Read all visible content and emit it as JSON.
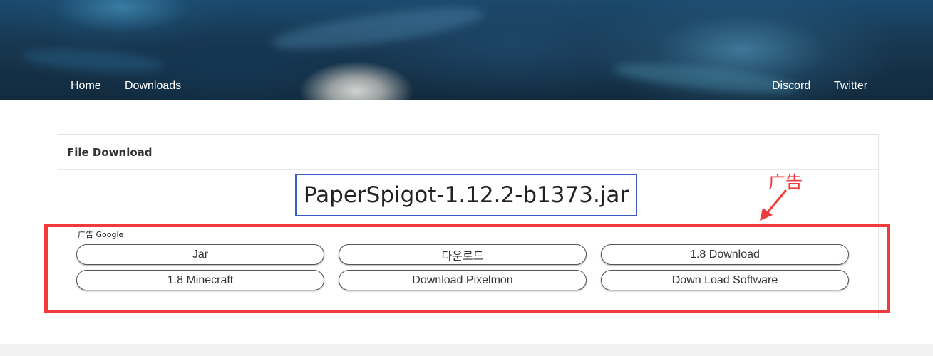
{
  "header": {
    "nav_left": [
      "Home",
      "Downloads"
    ],
    "nav_right": [
      "Discord",
      "Twitter"
    ]
  },
  "card": {
    "title": "File Download",
    "filename": "PaperSpigot-1.12.2-b1373.jar"
  },
  "ad": {
    "label": "广告 Google",
    "buttons": [
      "Jar",
      "다운로드",
      "1.8 Download",
      "1.8 Minecraft",
      "Download Pixelmon",
      "Down Load Software"
    ]
  },
  "annotation": {
    "text": "广告"
  },
  "colors": {
    "annotation_red": "#ef3b3b",
    "highlight_blue": "#3b5bc7"
  }
}
